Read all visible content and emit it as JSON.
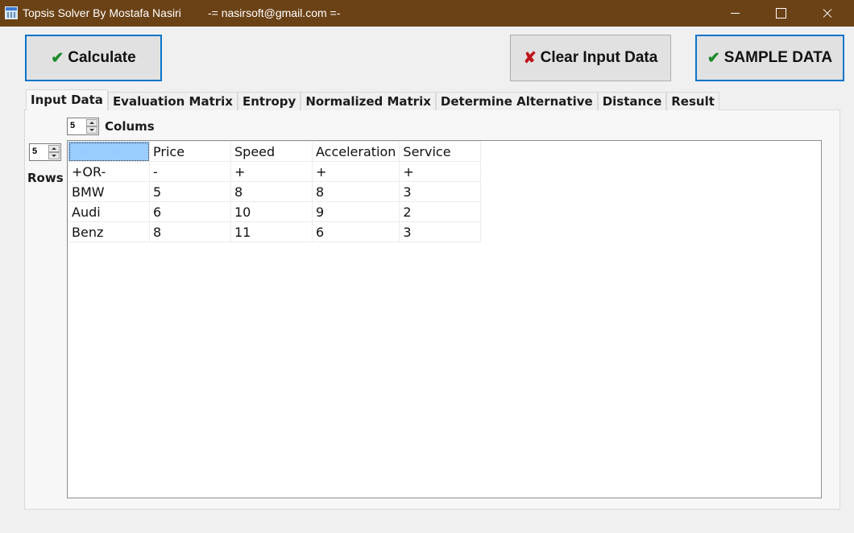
{
  "window": {
    "title": "Topsis Solver By Mostafa Nasiri",
    "contact": "-= nasirsoft@gmail.com =-"
  },
  "buttons": {
    "calculate": "Calculate",
    "clear": "Clear Input Data",
    "sample": "SAMPLE DATA"
  },
  "tabs": [
    "Input Data",
    "Evaluation Matrix",
    "Entropy",
    "Normalized Matrix",
    "Determine Alternative",
    "Distance",
    "Result"
  ],
  "columns_spinner": {
    "value": "5",
    "label": "Colums"
  },
  "rows_spinner": {
    "value": "5",
    "label": "Rows"
  },
  "grid": {
    "rows": [
      [
        "",
        "Price",
        "Speed",
        "Acceleration",
        "Service"
      ],
      [
        "+OR-",
        "-",
        "+",
        "+",
        "+"
      ],
      [
        "BMW",
        "5",
        "8",
        "8",
        "3"
      ],
      [
        "Audi",
        "6",
        "10",
        "9",
        "2"
      ],
      [
        "Benz",
        "8",
        "11",
        "6",
        "3"
      ]
    ]
  },
  "colors": {
    "titlebar": "#6b4216",
    "selected_cell": "#99ccff",
    "focus_border": "#0a74c9",
    "check": "#1a8a2a",
    "cross": "#c0151b"
  }
}
